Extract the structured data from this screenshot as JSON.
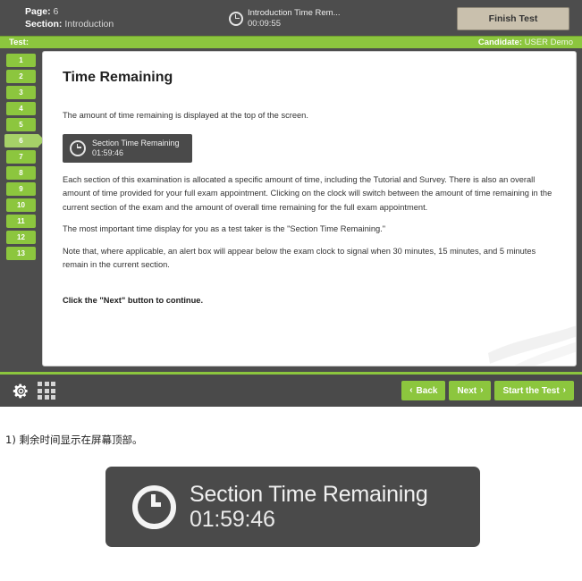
{
  "header": {
    "page_label": "Page:",
    "page_value": "6",
    "section_label": "Section:",
    "section_value": "Introduction",
    "clock_icon": "clock-icon",
    "clock_label": "Introduction Time Rem...",
    "clock_time": "00:09:55",
    "finish_button": "Finish Test"
  },
  "candidate_bar": {
    "test_label": "Test:",
    "test_value": "",
    "candidate_label": "Candidate:",
    "candidate_value": "USER Demo"
  },
  "sidebar": {
    "items": [
      {
        "label": "1",
        "active": false
      },
      {
        "label": "2",
        "active": false
      },
      {
        "label": "3",
        "active": false
      },
      {
        "label": "4",
        "active": false
      },
      {
        "label": "5",
        "active": false
      },
      {
        "label": "6",
        "active": true
      },
      {
        "label": "7",
        "active": false
      },
      {
        "label": "8",
        "active": false
      },
      {
        "label": "9",
        "active": false
      },
      {
        "label": "10",
        "active": false
      },
      {
        "label": "11",
        "active": false
      },
      {
        "label": "12",
        "active": false
      },
      {
        "label": "13",
        "active": false
      }
    ]
  },
  "content": {
    "title": "Time Remaining",
    "intro": "The amount of time remaining is displayed at the top of the screen.",
    "inline_clock": {
      "icon": "clock-icon",
      "label": "Section Time Remaining",
      "time": "01:59:46"
    },
    "paragraph_1": "Each section of this examination is allocated a specific amount of time, including the Tutorial and Survey. There is also an overall amount of time provided for your full exam appointment. Clicking on the clock will switch between the amount of time remaining in the current section of the exam and the amount of overall time remaining for the full exam appointment.",
    "paragraph_2": "The most important time display for you as a test taker is the \"Section Time Remaining.\"",
    "paragraph_3": "Note that, where applicable, an alert box will appear below the exam clock to signal when 30 minutes, 15 minutes, and 5 minutes remain in the current section.",
    "call_to_action": "Click the \"Next\" button to continue."
  },
  "footer": {
    "gear_icon": "gear-icon",
    "grid_icon": "grid-icon",
    "back_button": "Back",
    "back_chevron": "‹",
    "next_button": "Next",
    "next_chevron": "›",
    "start_button": "Start the Test",
    "start_chevron": "›"
  },
  "annotation": {
    "caption": "1) 剩余时间显示在屏幕顶部。",
    "figure": {
      "icon": "clock-icon",
      "label": "Section Time Remaining",
      "time": "01:59:46"
    }
  },
  "colors": {
    "brand_green": "#8cc63e",
    "active_green": "#a6d168",
    "dark_chrome": "#4d4d4d",
    "footer_dark": "#4a4a4a",
    "finish_button": "#c9c0ad"
  }
}
